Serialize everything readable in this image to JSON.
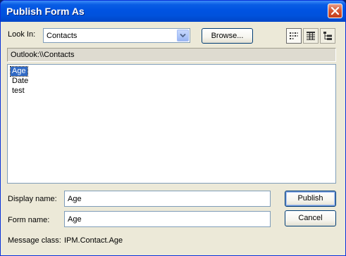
{
  "window": {
    "title": "Publish Form As"
  },
  "look_in": {
    "label": "Look In:",
    "value": "Contacts",
    "browse_label": "Browse..."
  },
  "view_buttons": [
    "list-view-icon",
    "details-view-icon",
    "tree-view-icon"
  ],
  "path": "Outlook:\\\\Contacts",
  "forms": {
    "items": [
      "Age",
      "Date",
      "test"
    ],
    "selected": "Age"
  },
  "display_name": {
    "label": "Display name:",
    "value": "Age"
  },
  "form_name": {
    "label": "Form name:",
    "value": "Age"
  },
  "message_class": {
    "label": "Message class:",
    "value": "IPM.Contact.Age"
  },
  "buttons": {
    "publish": "Publish",
    "cancel": "Cancel"
  },
  "colors": {
    "title_bar": "#0053e1",
    "dialog_bg": "#ece9d8",
    "selection": "#316ac5",
    "close_button": "#d65a37"
  }
}
